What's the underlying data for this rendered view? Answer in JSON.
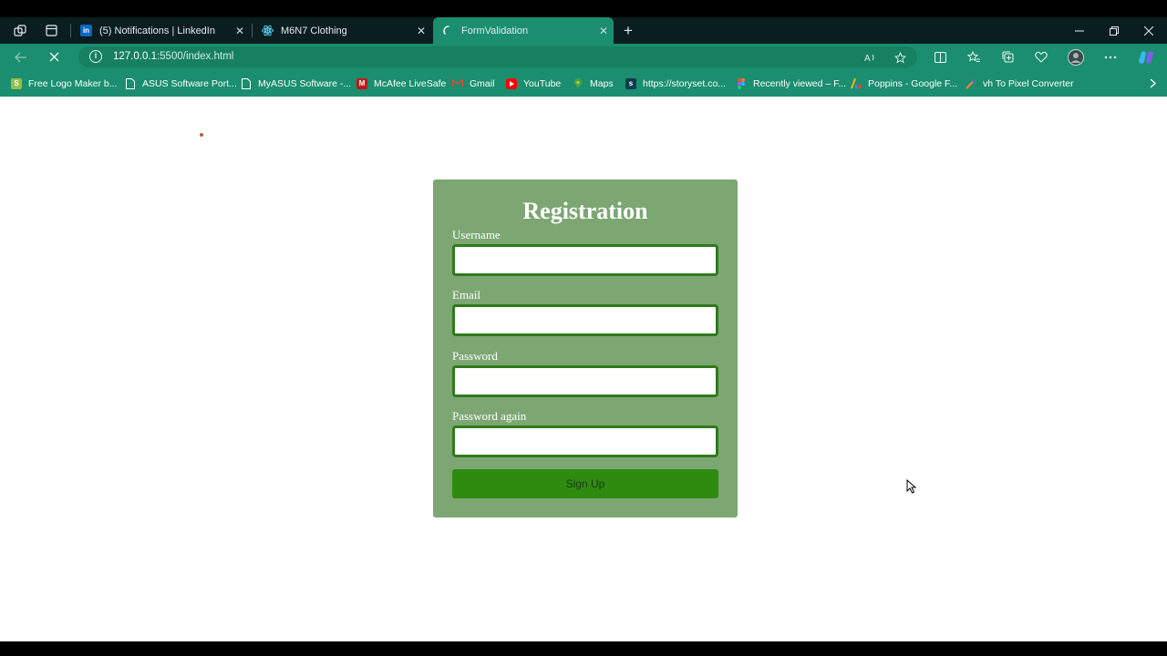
{
  "browser": {
    "tabs": [
      {
        "title": "(5) Notifications | LinkedIn",
        "favicon": "linkedin-icon",
        "favicon_color": "#0a66c2",
        "favicon_text": "in"
      },
      {
        "title": "M6N7 Clothing",
        "favicon": "react-icon",
        "favicon_color": "#61dafb"
      },
      {
        "title": "FormValidation",
        "favicon": "loading-icon",
        "active": true
      }
    ],
    "address": {
      "host": "127.0.0.1",
      "path": ":5500/index.html"
    },
    "bookmarks": [
      {
        "label": "Free Logo Maker b...",
        "icon": "shopify-icon",
        "color": "#95bf47"
      },
      {
        "label": "ASUS Software Port...",
        "icon": "page-icon",
        "color": "#ffffff"
      },
      {
        "label": "MyASUS Software -...",
        "icon": "page-icon",
        "color": "#ffffff"
      },
      {
        "label": "McAfee LiveSafe",
        "icon": "mcafee-icon",
        "color": "#c01818"
      },
      {
        "label": "Gmail",
        "icon": "gmail-icon",
        "color": "#ea4335"
      },
      {
        "label": "YouTube",
        "icon": "youtube-icon",
        "color": "#ff0000"
      },
      {
        "label": "Maps",
        "icon": "maps-icon",
        "color": "#34a853"
      },
      {
        "label": "https://storyset.co...",
        "icon": "storyset-icon",
        "color": "#0b3d4c"
      },
      {
        "label": "Recently viewed – F...",
        "icon": "figma-icon",
        "color": "#a259ff"
      },
      {
        "label": "Poppins - Google F...",
        "icon": "google-fonts-icon",
        "color": "#fbbc04"
      },
      {
        "label": "vh To Pixel Converter",
        "icon": "converter-icon",
        "color": "#ff7a45"
      }
    ]
  },
  "form": {
    "title": "Registration",
    "fields": [
      {
        "label": "Username",
        "value": ""
      },
      {
        "label": "Email",
        "value": ""
      },
      {
        "label": "Password",
        "value": ""
      },
      {
        "label": "Password again",
        "value": ""
      }
    ],
    "submit_label": "Sign Up"
  },
  "colors": {
    "browser_accent": "#1a8e6e",
    "card_bg": "#7ca773",
    "field_border": "#2f7a1c",
    "button_bg": "#2e8b10"
  }
}
